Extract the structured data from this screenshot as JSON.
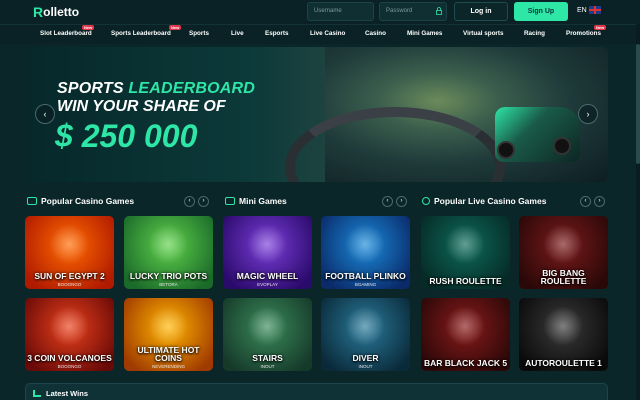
{
  "header": {
    "logo_text": "olletto",
    "logo_letter": "R",
    "username_placeholder": "Username",
    "password_placeholder": "Password",
    "login_label": "Log in",
    "signup_label": "Sign Up",
    "language": "EN"
  },
  "nav": {
    "items": [
      {
        "label": "Slot Leaderboard",
        "badge": "New"
      },
      {
        "label": "Sports Leaderboard",
        "badge": "New"
      },
      {
        "label": "Sports"
      },
      {
        "label": "Live"
      },
      {
        "label": "Esports"
      },
      {
        "label": "Live Casino"
      },
      {
        "label": "Casino"
      },
      {
        "label": "Mini Games"
      },
      {
        "label": "Virtual sports"
      },
      {
        "label": "Racing"
      },
      {
        "label": "Promotions",
        "badge": "New"
      }
    ]
  },
  "banner": {
    "line1_white": "SPORTS",
    "line1_accent": "LEADERBOARD",
    "line2": "WIN YOUR SHARE OF",
    "amount": "$ 250 000",
    "prev": "‹",
    "next": "›",
    "slide_count": 14,
    "active_slide": 2
  },
  "sections": {
    "popular_casino": "Popular Casino Games",
    "mini_games": "Mini Games",
    "popular_live": "Popular Live Casino Games",
    "prev": "‹",
    "next": "›"
  },
  "games": [
    {
      "title": "SUN OF EGYPT 2",
      "provider": "BOOONGO",
      "c1": "#ff6a00",
      "c2": "#b01a00"
    },
    {
      "title": "LUCKY TRIO POTS",
      "provider": "BETORA",
      "c1": "#5fd04a",
      "c2": "#1a6a2a"
    },
    {
      "title": "MAGIC WHEEL",
      "provider": "EVOPLAY",
      "c1": "#7a3dd8",
      "c2": "#2a0a6a"
    },
    {
      "title": "FOOTBALL PLINKO",
      "provider": "BGAMING",
      "c1": "#1a8ad8",
      "c2": "#0a2a6a"
    },
    {
      "title": "RUSH ROULETTE",
      "provider": "",
      "c1": "#0d6a5a",
      "c2": "#062a26"
    },
    {
      "title": "BIG BANG ROULETTE",
      "provider": "",
      "c1": "#7a1a1a",
      "c2": "#2a0808"
    },
    {
      "title": "3 COIN VOLCANOES",
      "provider": "BOOONGO",
      "c1": "#e8401a",
      "c2": "#6a0a08"
    },
    {
      "title": "ULTIMATE HOT COINS",
      "provider": "NEVERENDING",
      "c1": "#ffb400",
      "c2": "#a03a00"
    },
    {
      "title": "STAIRS",
      "provider": "INOUT",
      "c1": "#3a8a5a",
      "c2": "#163a2a"
    },
    {
      "title": "DIVER",
      "provider": "INOUT",
      "c1": "#2a7a9a",
      "c2": "#0a2a3a"
    },
    {
      "title": "BAR BLACK JACK 5",
      "provider": "",
      "c1": "#8a1a1a",
      "c2": "#2a0808"
    },
    {
      "title": "AUTOROULETTE 1",
      "provider": "",
      "c1": "#3a3a3a",
      "c2": "#0a0a0a"
    }
  ],
  "latest_wins": "Latest Wins",
  "colors": {
    "accent": "#2ee6a6",
    "background": "#0b2629",
    "badge": "#e0334a"
  }
}
